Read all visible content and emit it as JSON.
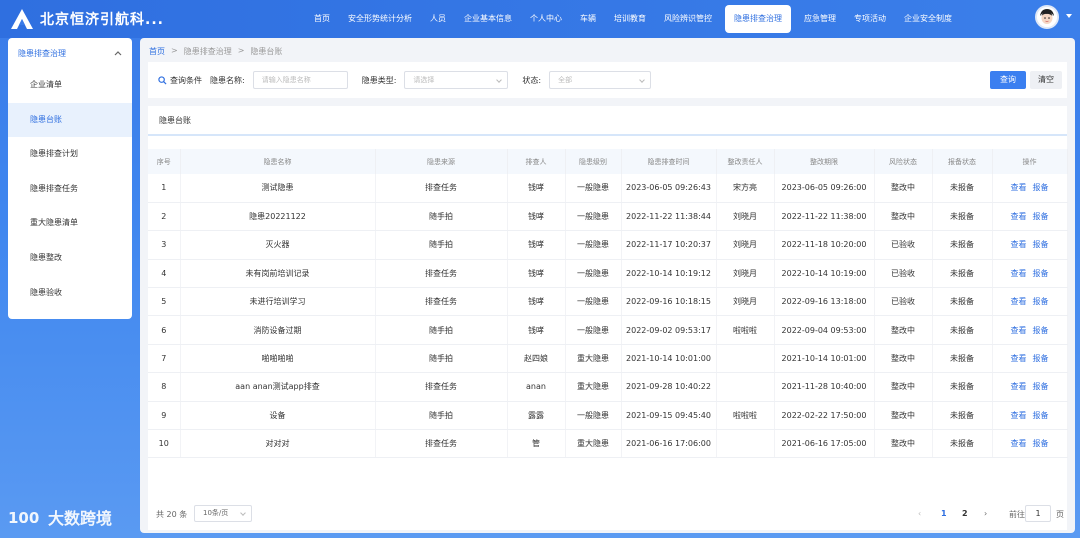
{
  "app": {
    "title": "北京恒济引航科..."
  },
  "nav": {
    "items": [
      {
        "label": "首页"
      },
      {
        "label": "安全形势统计分析"
      },
      {
        "label": "人员"
      },
      {
        "label": "企业基本信息"
      },
      {
        "label": "个人中心"
      },
      {
        "label": "车辆"
      },
      {
        "label": "培训教育"
      },
      {
        "label": "风险辨识管控"
      },
      {
        "label": "隐患排查治理"
      },
      {
        "label": "应急管理"
      },
      {
        "label": "专项活动"
      },
      {
        "label": "企业安全制度"
      }
    ],
    "active_index": 8
  },
  "sidebar": {
    "header": "隐患排查治理",
    "items": [
      {
        "label": "企业清单"
      },
      {
        "label": "隐患台账"
      },
      {
        "label": "隐患排查计划"
      },
      {
        "label": "隐患排查任务"
      },
      {
        "label": "重大隐患清单"
      },
      {
        "label": "隐患整改"
      },
      {
        "label": "隐患验收"
      }
    ],
    "active_index": 1
  },
  "breadcrumb": [
    "首页",
    "隐患排查治理",
    "隐患台账"
  ],
  "filter": {
    "title": "查询条件",
    "name_label": "隐患名称:",
    "name_placeholder": "请输入隐患名称",
    "type_label": "隐患类型:",
    "type_placeholder": "请选择",
    "status_label": "状态:",
    "status_value": "全部",
    "query_button": "查询",
    "clear_button": "清空"
  },
  "table": {
    "title": "隐患台账",
    "columns": [
      "序号",
      "隐患名称",
      "隐患来源",
      "排查人",
      "隐患级别",
      "隐患排查时间",
      "整改责任人",
      "整改期限",
      "风险状态",
      "报备状态",
      "操作"
    ],
    "rows": [
      [
        "1",
        "测试隐患",
        "排查任务",
        "钱哮",
        "一般隐患",
        "2023-06-05 09:26:43",
        "宋方亮",
        "2023-06-05 09:26:00",
        "整改中",
        "未报备"
      ],
      [
        "2",
        "隐患20221122",
        "随手拍",
        "钱哮",
        "一般隐患",
        "2022-11-22 11:38:44",
        "刘晓月",
        "2022-11-22 11:38:00",
        "整改中",
        "未报备"
      ],
      [
        "3",
        "灭火器",
        "随手拍",
        "钱哮",
        "一般隐患",
        "2022-11-17 10:20:37",
        "刘晓月",
        "2022-11-18 10:20:00",
        "已验收",
        "未报备"
      ],
      [
        "4",
        "未有岗前培训记录",
        "排查任务",
        "钱哮",
        "一般隐患",
        "2022-10-14 10:19:12",
        "刘晓月",
        "2022-10-14 10:19:00",
        "已验收",
        "未报备"
      ],
      [
        "5",
        "未进行培训学习",
        "排查任务",
        "钱哮",
        "一般隐患",
        "2022-09-16 10:18:15",
        "刘晓月",
        "2022-09-16 13:18:00",
        "已验收",
        "未报备"
      ],
      [
        "6",
        "消防设备过期",
        "随手拍",
        "钱哮",
        "一般隐患",
        "2022-09-02 09:53:17",
        "啦啦啦",
        "2022-09-04 09:53:00",
        "整改中",
        "未报备"
      ],
      [
        "7",
        "啪啪啪啪",
        "随手拍",
        "赵四娘",
        "重大隐患",
        "2021-10-14 10:01:00",
        "",
        "2021-10-14 10:01:00",
        "整改中",
        "未报备"
      ],
      [
        "8",
        "aan anan测试app排查",
        "排查任务",
        "anan",
        "重大隐患",
        "2021-09-28 10:40:22",
        "",
        "2021-11-28 10:40:00",
        "整改中",
        "未报备"
      ],
      [
        "9",
        "设备",
        "随手拍",
        "露露",
        "一般隐患",
        "2021-09-15 09:45:40",
        "啦啦啦",
        "2022-02-22 17:50:00",
        "整改中",
        "未报备"
      ],
      [
        "10",
        "对对对",
        "排查任务",
        "管",
        "重大隐患",
        "2021-06-16 17:06:00",
        "",
        "2021-06-16 17:05:00",
        "整改中",
        "未报备"
      ]
    ],
    "action_view": "查看",
    "action_report": "报备"
  },
  "pagination": {
    "total_text": "共 20 条",
    "page_size": "10条/页",
    "pages": [
      "1",
      "2"
    ],
    "current_page": "1",
    "goto_label": "前往",
    "goto_value": "1",
    "page_suffix": "页"
  },
  "watermark": {
    "text": "大数跨境"
  },
  "colors": {
    "primary": "#2f6fe0",
    "header_bg": "#3a7be8",
    "button_primary": "#3b7ff0"
  }
}
